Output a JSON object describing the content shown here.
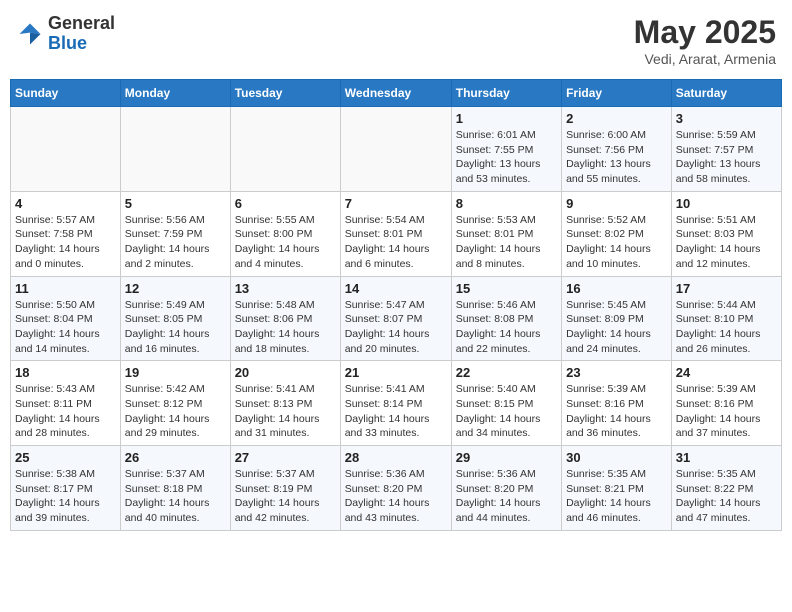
{
  "header": {
    "logo_general": "General",
    "logo_blue": "Blue",
    "month_title": "May 2025",
    "location": "Vedi, Ararat, Armenia"
  },
  "weekdays": [
    "Sunday",
    "Monday",
    "Tuesday",
    "Wednesday",
    "Thursday",
    "Friday",
    "Saturday"
  ],
  "weeks": [
    [
      {
        "day": "",
        "info": ""
      },
      {
        "day": "",
        "info": ""
      },
      {
        "day": "",
        "info": ""
      },
      {
        "day": "",
        "info": ""
      },
      {
        "day": "1",
        "info": "Sunrise: 6:01 AM\nSunset: 7:55 PM\nDaylight: 13 hours\nand 53 minutes."
      },
      {
        "day": "2",
        "info": "Sunrise: 6:00 AM\nSunset: 7:56 PM\nDaylight: 13 hours\nand 55 minutes."
      },
      {
        "day": "3",
        "info": "Sunrise: 5:59 AM\nSunset: 7:57 PM\nDaylight: 13 hours\nand 58 minutes."
      }
    ],
    [
      {
        "day": "4",
        "info": "Sunrise: 5:57 AM\nSunset: 7:58 PM\nDaylight: 14 hours\nand 0 minutes."
      },
      {
        "day": "5",
        "info": "Sunrise: 5:56 AM\nSunset: 7:59 PM\nDaylight: 14 hours\nand 2 minutes."
      },
      {
        "day": "6",
        "info": "Sunrise: 5:55 AM\nSunset: 8:00 PM\nDaylight: 14 hours\nand 4 minutes."
      },
      {
        "day": "7",
        "info": "Sunrise: 5:54 AM\nSunset: 8:01 PM\nDaylight: 14 hours\nand 6 minutes."
      },
      {
        "day": "8",
        "info": "Sunrise: 5:53 AM\nSunset: 8:01 PM\nDaylight: 14 hours\nand 8 minutes."
      },
      {
        "day": "9",
        "info": "Sunrise: 5:52 AM\nSunset: 8:02 PM\nDaylight: 14 hours\nand 10 minutes."
      },
      {
        "day": "10",
        "info": "Sunrise: 5:51 AM\nSunset: 8:03 PM\nDaylight: 14 hours\nand 12 minutes."
      }
    ],
    [
      {
        "day": "11",
        "info": "Sunrise: 5:50 AM\nSunset: 8:04 PM\nDaylight: 14 hours\nand 14 minutes."
      },
      {
        "day": "12",
        "info": "Sunrise: 5:49 AM\nSunset: 8:05 PM\nDaylight: 14 hours\nand 16 minutes."
      },
      {
        "day": "13",
        "info": "Sunrise: 5:48 AM\nSunset: 8:06 PM\nDaylight: 14 hours\nand 18 minutes."
      },
      {
        "day": "14",
        "info": "Sunrise: 5:47 AM\nSunset: 8:07 PM\nDaylight: 14 hours\nand 20 minutes."
      },
      {
        "day": "15",
        "info": "Sunrise: 5:46 AM\nSunset: 8:08 PM\nDaylight: 14 hours\nand 22 minutes."
      },
      {
        "day": "16",
        "info": "Sunrise: 5:45 AM\nSunset: 8:09 PM\nDaylight: 14 hours\nand 24 minutes."
      },
      {
        "day": "17",
        "info": "Sunrise: 5:44 AM\nSunset: 8:10 PM\nDaylight: 14 hours\nand 26 minutes."
      }
    ],
    [
      {
        "day": "18",
        "info": "Sunrise: 5:43 AM\nSunset: 8:11 PM\nDaylight: 14 hours\nand 28 minutes."
      },
      {
        "day": "19",
        "info": "Sunrise: 5:42 AM\nSunset: 8:12 PM\nDaylight: 14 hours\nand 29 minutes."
      },
      {
        "day": "20",
        "info": "Sunrise: 5:41 AM\nSunset: 8:13 PM\nDaylight: 14 hours\nand 31 minutes."
      },
      {
        "day": "21",
        "info": "Sunrise: 5:41 AM\nSunset: 8:14 PM\nDaylight: 14 hours\nand 33 minutes."
      },
      {
        "day": "22",
        "info": "Sunrise: 5:40 AM\nSunset: 8:15 PM\nDaylight: 14 hours\nand 34 minutes."
      },
      {
        "day": "23",
        "info": "Sunrise: 5:39 AM\nSunset: 8:16 PM\nDaylight: 14 hours\nand 36 minutes."
      },
      {
        "day": "24",
        "info": "Sunrise: 5:39 AM\nSunset: 8:16 PM\nDaylight: 14 hours\nand 37 minutes."
      }
    ],
    [
      {
        "day": "25",
        "info": "Sunrise: 5:38 AM\nSunset: 8:17 PM\nDaylight: 14 hours\nand 39 minutes."
      },
      {
        "day": "26",
        "info": "Sunrise: 5:37 AM\nSunset: 8:18 PM\nDaylight: 14 hours\nand 40 minutes."
      },
      {
        "day": "27",
        "info": "Sunrise: 5:37 AM\nSunset: 8:19 PM\nDaylight: 14 hours\nand 42 minutes."
      },
      {
        "day": "28",
        "info": "Sunrise: 5:36 AM\nSunset: 8:20 PM\nDaylight: 14 hours\nand 43 minutes."
      },
      {
        "day": "29",
        "info": "Sunrise: 5:36 AM\nSunset: 8:20 PM\nDaylight: 14 hours\nand 44 minutes."
      },
      {
        "day": "30",
        "info": "Sunrise: 5:35 AM\nSunset: 8:21 PM\nDaylight: 14 hours\nand 46 minutes."
      },
      {
        "day": "31",
        "info": "Sunrise: 5:35 AM\nSunset: 8:22 PM\nDaylight: 14 hours\nand 47 minutes."
      }
    ]
  ]
}
